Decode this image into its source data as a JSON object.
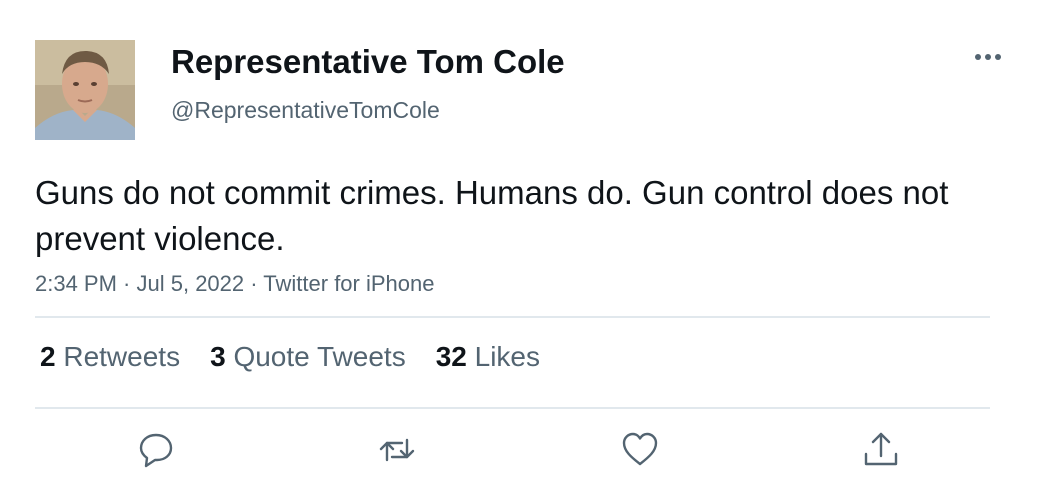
{
  "author": {
    "display_name": "Representative Tom Cole",
    "handle": "@RepresentativeTomCole",
    "avatar_icon": "profile-photo"
  },
  "tweet": {
    "text": "Guns do not commit crimes. Humans do. Gun control does not prevent violence.",
    "time": "2:34 PM",
    "separator": " · ",
    "date": "Jul 5, 2022",
    "source": "Twitter for iPhone"
  },
  "stats": {
    "retweets_count": "2",
    "retweets_label": "Retweets",
    "quotes_count": "3",
    "quotes_label": "Quote Tweets",
    "likes_count": "32",
    "likes_label": "Likes"
  },
  "actions": {
    "icons": [
      "reply-icon",
      "retweet-icon",
      "like-icon",
      "share-icon"
    ],
    "more_icon": "more-options-icon"
  },
  "colors": {
    "text_primary": "#0f1419",
    "text_secondary": "#536471",
    "divider": "#e1e8ed"
  }
}
